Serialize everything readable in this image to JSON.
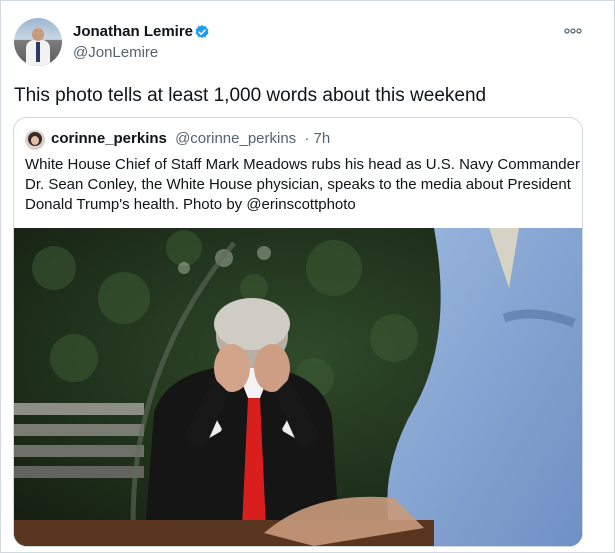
{
  "tweet": {
    "author_name": "Jonathan Lemire",
    "author_handle": "@JonLemire",
    "text": "This photo tells at least 1,000 words about this weekend",
    "verified_icon": "verified-badge-icon",
    "more_icon": "more-options-icon",
    "colors": {
      "verified": "#1d9bf0",
      "secondary_text": "#536471",
      "border": "#cfd9de"
    }
  },
  "quoted": {
    "author_name": "corinne_perkins",
    "author_handle": "@corinne_perkins",
    "time": "· 7h",
    "text_lines": [
      "White House Chief of Staff Mark Meadows rubs his head as U.S. Navy Commander",
      "Dr. Sean Conley, the White House physician, speaks to the media about President",
      "Donald Trump's health. Photo by @erinscottphoto"
    ]
  }
}
